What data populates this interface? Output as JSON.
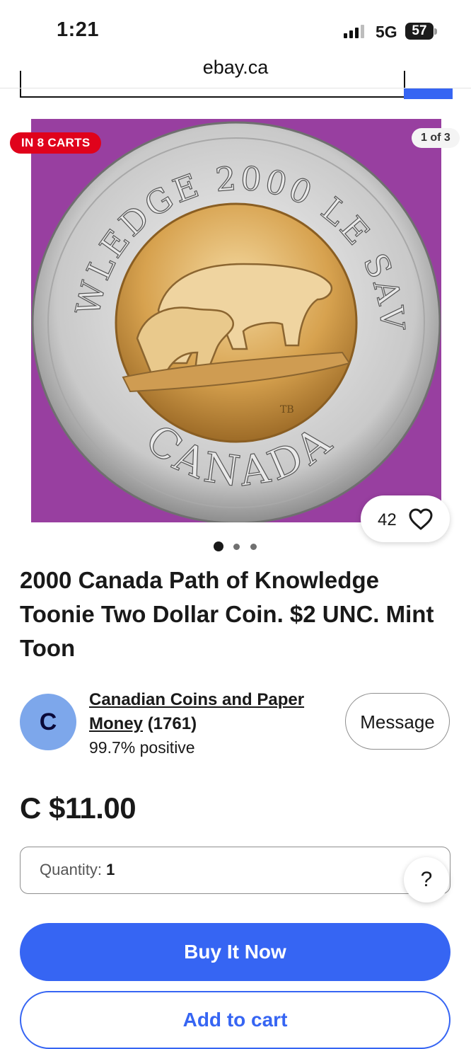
{
  "status_bar": {
    "time": "1:21",
    "network": "5G",
    "battery": "57"
  },
  "browser": {
    "url": "ebay.ca"
  },
  "gallery": {
    "badge": "IN 8 CARTS",
    "counter": "1 of 3",
    "watch_count": "42",
    "image": {
      "top_text": "KNOWLEDGE 2000 LE SAVOIR",
      "bottom_text": "CANADA",
      "initials": "TB"
    },
    "dots_total": 3,
    "dots_active": 1
  },
  "listing": {
    "title": "2000 Canada Path of Knowledge Toonie Two Dollar Coin. $2 UNC. Mint Toon",
    "price": "C $11.00"
  },
  "seller": {
    "avatar_letter": "C",
    "name": "Canadian Coins and Paper Money",
    "feedback_count": "(1761)",
    "feedback_pct": "99.7% positive",
    "message_label": "Message"
  },
  "quantity": {
    "label": "Quantity:",
    "value": "1"
  },
  "help": {
    "label": "?"
  },
  "actions": {
    "buy_label": "Buy It Now",
    "cart_label": "Add to cart"
  },
  "colors": {
    "ebay_blue": "#3665f3",
    "cart_badge_red": "#e0021b",
    "backdrop_purple": "#983fa0"
  }
}
